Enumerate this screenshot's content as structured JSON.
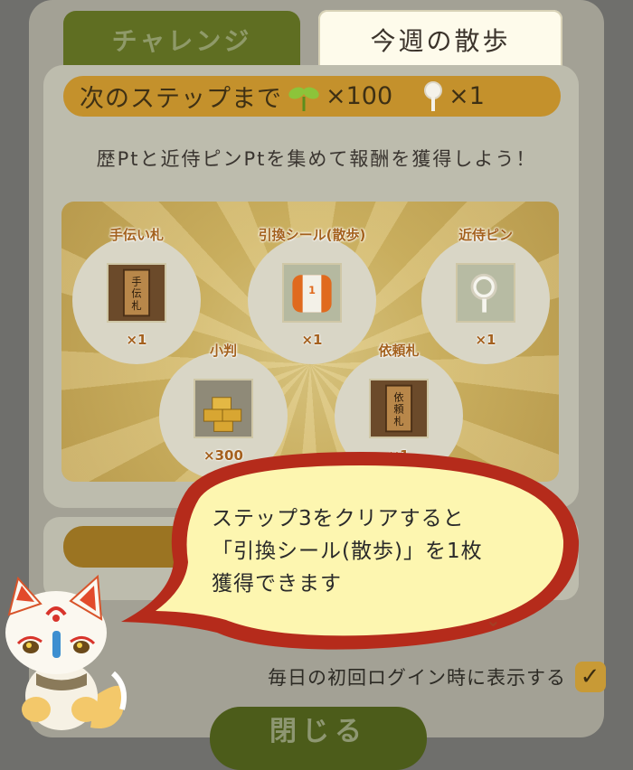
{
  "tabs": [
    {
      "label": "チャレンジ",
      "active": false
    },
    {
      "label": "今週の散歩",
      "active": true
    }
  ],
  "step_bar": {
    "prefix": "次のステップまで",
    "sprout_count": "×100",
    "pin_count": "×1"
  },
  "description": "歴Ptと近侍ピンPtを集めて報酬を獲得しよう！",
  "rewards": [
    {
      "name": "手伝い札",
      "qty": "×1",
      "icon": "tetsudai-fuda-icon"
    },
    {
      "name": "引換シール(散歩)",
      "qty": "×1",
      "icon": "exchange-seal-icon"
    },
    {
      "name": "近侍ピン",
      "qty": "×1",
      "icon": "kinji-pin-icon"
    },
    {
      "name": "小判",
      "qty": "×300",
      "icon": "koban-icon"
    },
    {
      "name": "依頼札",
      "qty": "×1",
      "icon": "irai-fuda-icon"
    }
  ],
  "bubble": {
    "line1": "ステップ3をクリアすると",
    "line2": "「引換シール(散歩)」を1枚",
    "line3": "獲得できます"
  },
  "login_toggle": {
    "label": "毎日の初回ログイン時に表示する",
    "checked": true
  },
  "close_button": "閉じる",
  "colors": {
    "tab_active_bg": "#fefbeb",
    "tab_inactive_bg": "#5f6e22",
    "step_bar_bg": "#c4912c",
    "reward_label": "#a3611d",
    "bubble_fill": "#fdf6b0",
    "bubble_border": "#b52b1b"
  }
}
